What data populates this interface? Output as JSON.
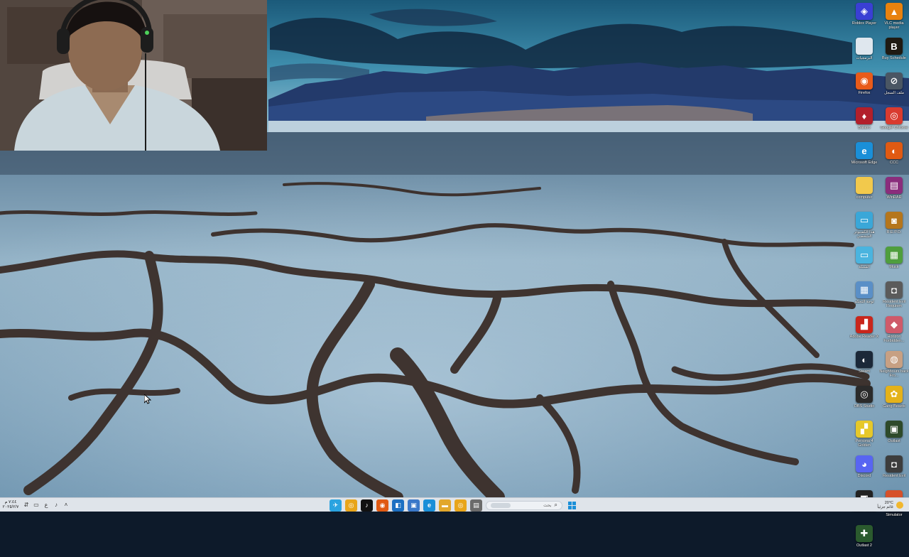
{
  "desktop_icons": [
    {
      "label": "Roblox Player",
      "glyph": "◈",
      "color": "#3a3fd4",
      "icon": "roblox-player-icon"
    },
    {
      "label": "VLC media player",
      "glyph": "▲",
      "color": "#e8820e",
      "icon": "vlc-icon"
    },
    {
      "label": "البرمجيات",
      "glyph": "",
      "color": "#dfe7ee",
      "icon": "folder-shortcut-icon"
    },
    {
      "label": "Buy Schedule",
      "glyph": "B",
      "color": "#1f1a12",
      "icon": "game-b-icon"
    },
    {
      "label": "Firefox",
      "glyph": "◉",
      "color": "#e85b1a",
      "icon": "firefox-icon"
    },
    {
      "label": "ملف السجل",
      "glyph": "⊘",
      "color": "#4a5663",
      "icon": "shortcut-icon"
    },
    {
      "label": "Balatro",
      "glyph": "♦",
      "color": "#b21f2b",
      "icon": "balatro-icon"
    },
    {
      "label": "Google Chrome",
      "glyph": "◎",
      "color": "#d93a2f",
      "icon": "chrome-icon"
    },
    {
      "label": "Microsoft Edge",
      "glyph": "e",
      "color": "#1a8fd8",
      "icon": "edge-icon"
    },
    {
      "label": "CCC",
      "glyph": "◐",
      "color": "#e05a12",
      "icon": "ccleaner-icon"
    },
    {
      "label": "computer",
      "glyph": "",
      "color": "#f2c94c",
      "icon": "folder-icon"
    },
    {
      "label": "WinRAR",
      "glyph": "▤",
      "color": "#8a2d7c",
      "icon": "winrar-icon"
    },
    {
      "label": "هذا الكمبيوتر الشخصي",
      "glyph": "▭",
      "color": "#3aa7d8",
      "icon": "this-pc-icon"
    },
    {
      "label": "R.E.P.O.",
      "glyph": "◙",
      "color": "#b5761c",
      "icon": "repo-icon"
    },
    {
      "label": "الشبكة",
      "glyph": "▭",
      "color": "#4ab4df",
      "icon": "network-icon"
    },
    {
      "label": "Muck",
      "glyph": "▦",
      "color": "#4f9e3d",
      "icon": "muck-icon"
    },
    {
      "label": "لوحة التحكم",
      "glyph": "▦",
      "color": "#5a8fc7",
      "icon": "control-panel-icon"
    },
    {
      "label": "Resident Evil Requiem",
      "glyph": "◘",
      "color": "#5b5b5b",
      "icon": "resident-evil-requiem-icon"
    },
    {
      "label": "Adobe Reader X",
      "glyph": "▟",
      "color": "#c9261c",
      "icon": "adobe-reader-icon"
    },
    {
      "label": "Horizon Forbidden...",
      "glyph": "◆",
      "color": "#cf5a6a",
      "icon": "horizon-icon"
    },
    {
      "label": "Steam",
      "glyph": "◐",
      "color": "#1b2838",
      "icon": "steam-icon"
    },
    {
      "label": "Neighbours back Fro...",
      "glyph": "◍",
      "color": "#c7a083",
      "icon": "neighbours-icon"
    },
    {
      "label": "OBS Studio",
      "glyph": "◎",
      "color": "#2b2b2b",
      "icon": "obs-icon"
    },
    {
      "label": "Gang Beasts",
      "glyph": "✿",
      "color": "#e4b21a",
      "icon": "gang-beasts-icon"
    },
    {
      "label": "Persona 4 Golden",
      "glyph": "▞",
      "color": "#e6c82a",
      "icon": "persona-icon"
    },
    {
      "label": "Outlast",
      "glyph": "▣",
      "color": "#2e4a2a",
      "icon": "outlast-icon"
    },
    {
      "label": "Discord",
      "glyph": "◕",
      "color": "#5865f2",
      "icon": "discord-icon"
    },
    {
      "label": "Resident Evil",
      "glyph": "◘",
      "color": "#3d3d3d",
      "icon": "resident-evil-icon"
    },
    {
      "label": "Roblox Studio",
      "glyph": "◩",
      "color": "#222222",
      "icon": "roblox-studio-icon"
    },
    {
      "label": "Gas Station Simulator",
      "glyph": "◕",
      "color": "#d6502a",
      "icon": "gas-station-icon"
    },
    {
      "label": "Outlast 2",
      "glyph": "✚",
      "color": "#2b5a2e",
      "icon": "outlast-2-icon"
    }
  ],
  "taskbar": {
    "clock_time": "٧:٤٤ م",
    "clock_date": "٢٠٢٥/٢/٧",
    "tray_left": [
      {
        "glyph": "⇵",
        "icon": "network-tray-icon"
      },
      {
        "glyph": "▭",
        "icon": "battery-tray-icon"
      },
      {
        "glyph": "ع",
        "icon": "language-tray-icon"
      },
      {
        "glyph": "♪",
        "icon": "volume-tray-icon"
      },
      {
        "glyph": "˄",
        "icon": "chevron-up-icon"
      }
    ],
    "apps": [
      {
        "glyph": "✈",
        "color": "#2aa3e0",
        "icon": "telegram-icon"
      },
      {
        "glyph": "◎",
        "color": "#e8a51a",
        "icon": "chrome-taskbar-icon"
      },
      {
        "glyph": "♪",
        "color": "#111111",
        "icon": "tiktok-icon"
      },
      {
        "glyph": "◉",
        "color": "#e05a12",
        "icon": "opera-icon"
      },
      {
        "glyph": "◧",
        "color": "#1b6fc2",
        "icon": "steam-taskbar-icon"
      },
      {
        "glyph": "▣",
        "color": "#3a78c9",
        "icon": "store-icon"
      },
      {
        "glyph": "e",
        "color": "#1a8fd8",
        "icon": "edge-taskbar-icon"
      },
      {
        "glyph": "▬",
        "color": "#e2a72b",
        "icon": "file-explorer-icon"
      },
      {
        "glyph": "◎",
        "color": "#e8a51a",
        "icon": "chrome-taskbar-2-icon"
      },
      {
        "glyph": "▤",
        "color": "#6b6b6b",
        "icon": "task-view-icon"
      }
    ],
    "search_placeholder": "بحث",
    "start_color": "#1a8fd8",
    "weather_temp": "20°C",
    "weather_text": "غائم جزئياً"
  }
}
